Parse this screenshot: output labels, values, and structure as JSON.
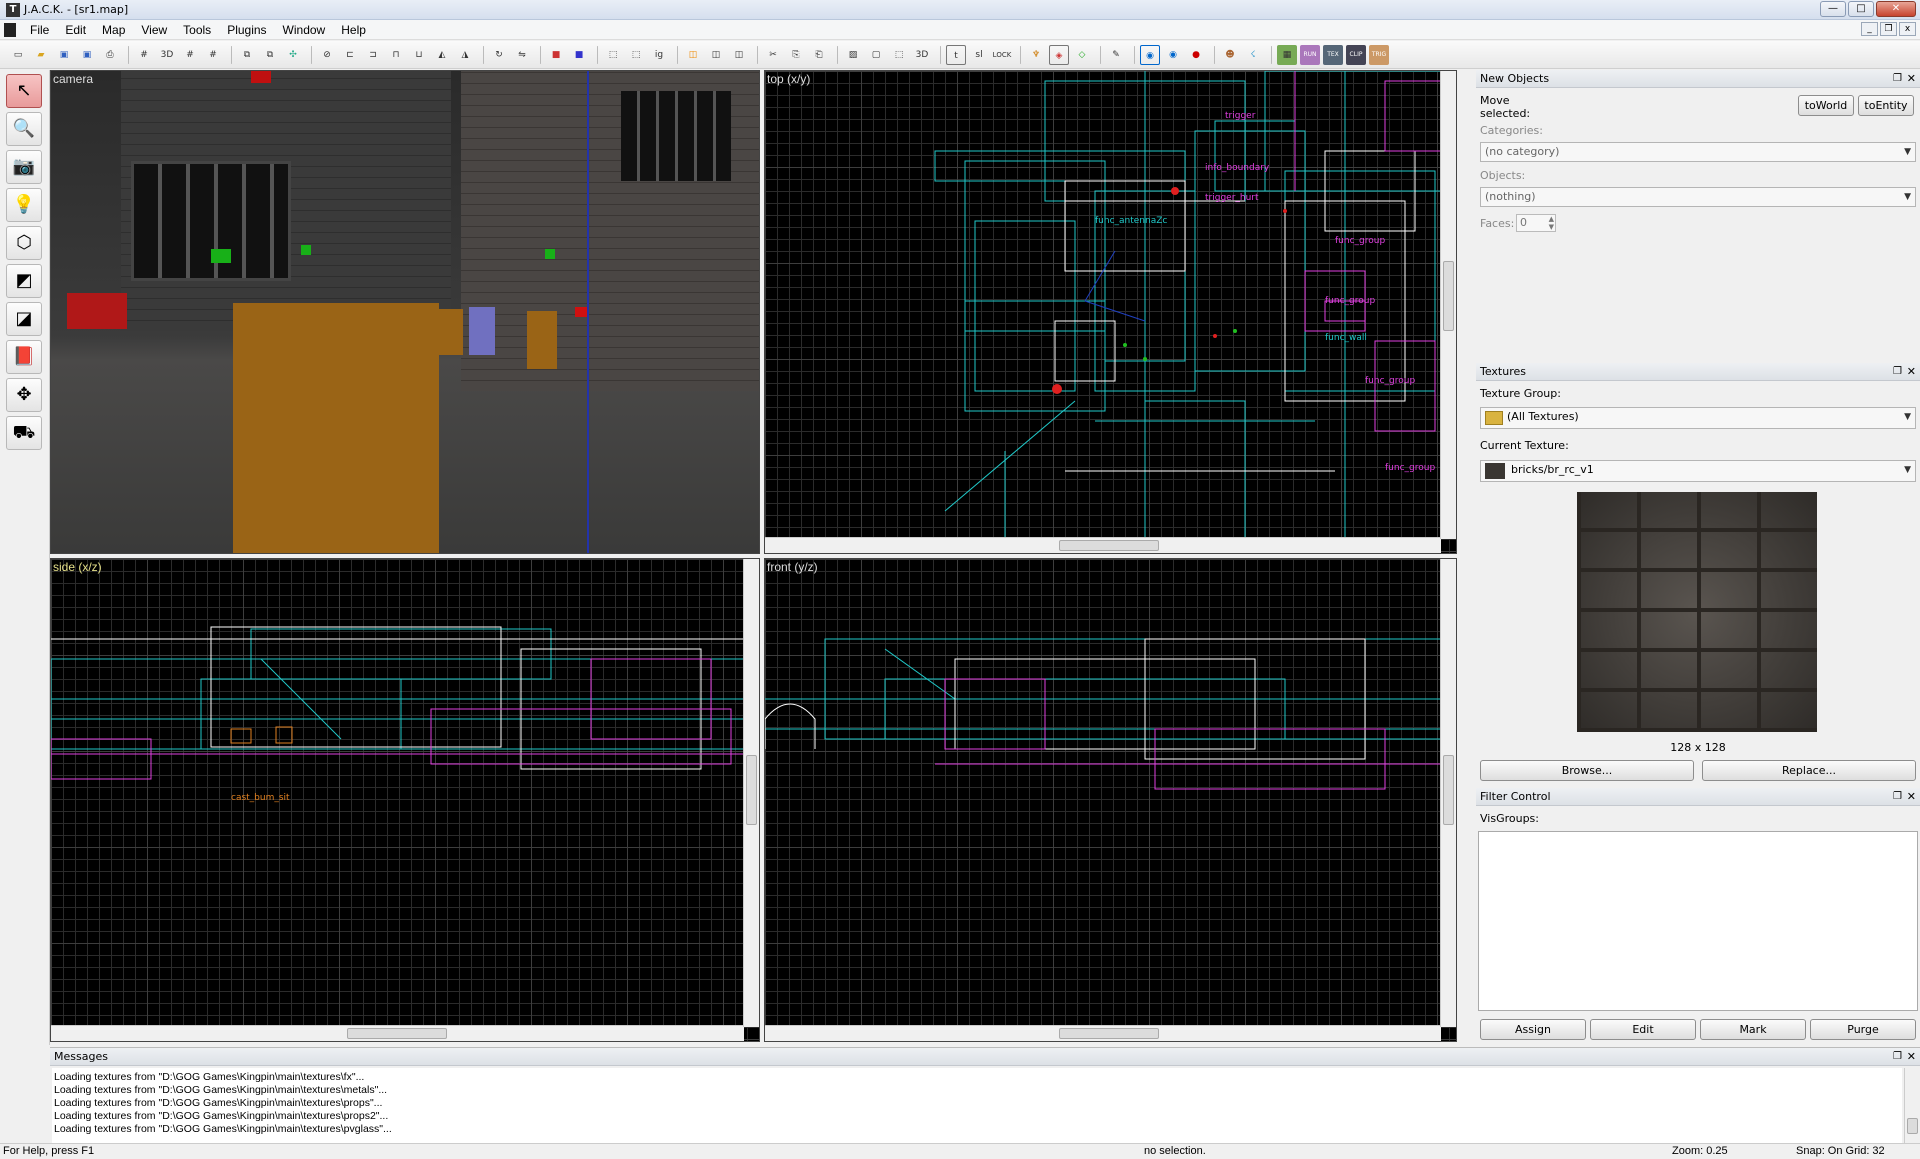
{
  "window": {
    "title": "J.A.C.K. - [sr1.map]",
    "minimize": "—",
    "maximize": "□",
    "close": "✕"
  },
  "menu": {
    "items": [
      "File",
      "Edit",
      "Map",
      "View",
      "Tools",
      "Plugins",
      "Window",
      "Help"
    ]
  },
  "mdi": {
    "minimize": "_",
    "restore": "❐",
    "close": "x"
  },
  "toolbar": {
    "labels": [
      "3D",
      "t",
      "sl",
      "LOCK",
      "RUN",
      "CLIP",
      "TRIG"
    ]
  },
  "viewports": {
    "camera": "camera",
    "top": "top (x/y)",
    "side": "side (x/z)",
    "front": "front (y/z)"
  },
  "entity_labels": {
    "top": [
      "func_group",
      "trigger",
      "info_boundary",
      "func_group",
      "trigger_hurt",
      "func_antennaZc",
      "func_wall",
      "func_group",
      "func_group"
    ],
    "side": [
      "cast_bum_sit"
    ]
  },
  "new_objects": {
    "title": "New Objects",
    "move_label": "Move selected:",
    "to_world": "toWorld",
    "to_entity": "toEntity",
    "categories_label": "Categories:",
    "categories_value": "(no category)",
    "objects_label": "Objects:",
    "objects_value": "(nothing)",
    "faces_label": "Faces:",
    "faces_value": "0"
  },
  "textures": {
    "title": "Textures",
    "group_label": "Texture Group:",
    "group_value": "(All Textures)",
    "current_label": "Current Texture:",
    "current_value": "bricks/br_rc_v1",
    "size": "128 x 128",
    "browse": "Browse...",
    "replace": "Replace..."
  },
  "filter": {
    "title": "Filter Control",
    "visgroups_label": "VisGroups:",
    "assign": "Assign",
    "edit": "Edit",
    "mark": "Mark",
    "purge": "Purge"
  },
  "messages": {
    "title": "Messages",
    "lines": [
      "Loading textures from \"D:\\GOG Games\\Kingpin\\main\\textures\\fx\"...",
      "Loading textures from \"D:\\GOG Games\\Kingpin\\main\\textures\\metals\"...",
      "Loading textures from \"D:\\GOG Games\\Kingpin\\main\\textures\\props\"...",
      "Loading textures from \"D:\\GOG Games\\Kingpin\\main\\textures\\props2\"...",
      "Loading textures from \"D:\\GOG Games\\Kingpin\\main\\textures\\pvglass\"..."
    ]
  },
  "status": {
    "help": "For Help, press F1",
    "selection": "no selection.",
    "zoom": "Zoom: 0.25",
    "snap": "Snap: On Grid: 32"
  },
  "colors": {
    "accent_cyan": "#20c8c8",
    "accent_magenta": "#e040e0",
    "accent_white": "#ffffff",
    "grid": "#2b2b2b"
  }
}
